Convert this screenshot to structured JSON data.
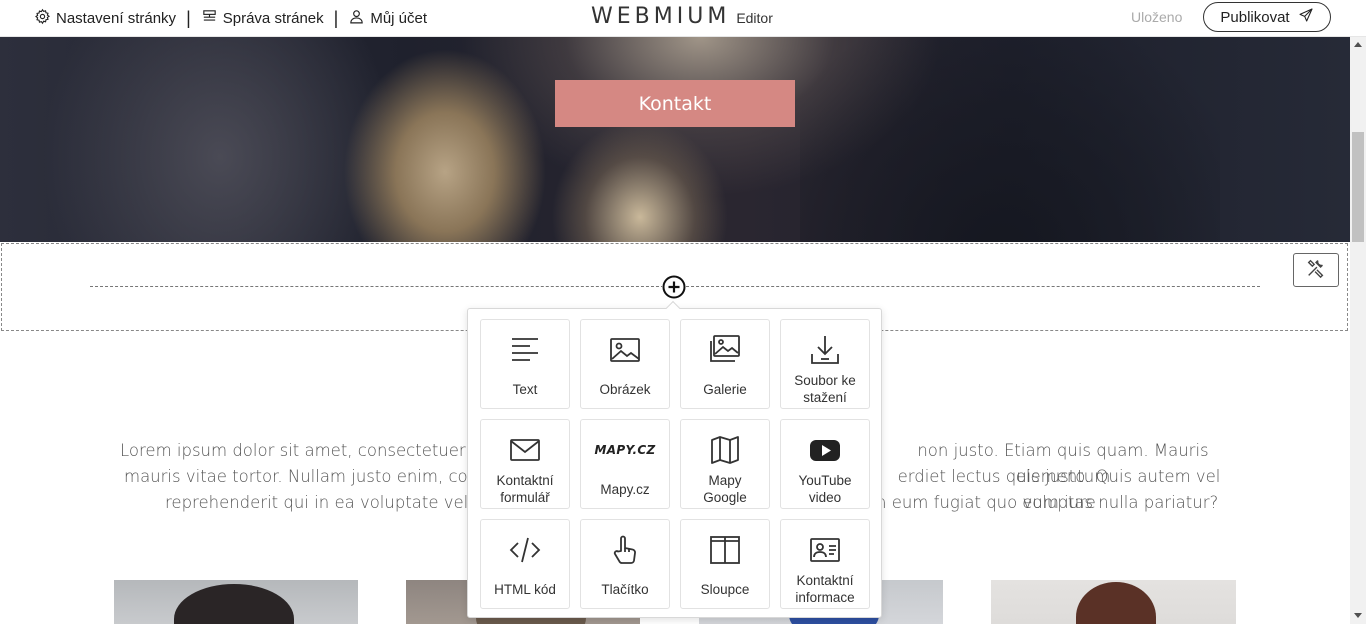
{
  "topbar": {
    "nav": [
      {
        "label": "Nastavení stránky",
        "icon": "gear-icon"
      },
      {
        "label": "Správa stránek",
        "icon": "pages-icon"
      },
      {
        "label": "Můj účet",
        "icon": "user-icon"
      }
    ],
    "separator": "|",
    "logo": "WEBMIUM",
    "logo_sub": "Editor",
    "status": "Uloženo",
    "publish_label": "Publikovat"
  },
  "hero": {
    "button_label": "Kontakt"
  },
  "picker": {
    "tiles": [
      {
        "label": "Text",
        "icon": "text-align-icon"
      },
      {
        "label": "Obrázek",
        "icon": "image-icon"
      },
      {
        "label": "Galerie",
        "icon": "gallery-icon"
      },
      {
        "label": "Soubor ke stažení",
        "icon": "download-icon"
      },
      {
        "label": "Kontaktní formulář",
        "icon": "envelope-icon"
      },
      {
        "label": "Mapy.cz",
        "icon": "mapy-cz-logo"
      },
      {
        "label": "Mapy Google",
        "icon": "map-icon"
      },
      {
        "label": "YouTube video",
        "icon": "youtube-icon"
      },
      {
        "label": "HTML kód",
        "icon": "code-icon"
      },
      {
        "label": "Tlačítko",
        "icon": "hand-pointer-icon"
      },
      {
        "label": "Sloupce",
        "icon": "columns-icon"
      },
      {
        "label": "Kontaktní informace",
        "icon": "contact-card-icon"
      }
    ],
    "mapy_logo_text": "MAPY.CZ"
  },
  "content": {
    "paragraph_visible_left": [
      "Lorem ipsum dolor sit amet, consectetuer adipis",
      "mauris vitae tortor. Nullam justo enim, consecte",
      "reprehenderit qui in ea voluptate velit ess"
    ],
    "paragraph_visible_right": [
      "non justo. Etiam quis quam. Mauris elementum",
      "erdiet lectus quis justo. Quis autem vel eum iure",
      "n eum fugiat quo voluptas nulla pariatur?"
    ]
  }
}
